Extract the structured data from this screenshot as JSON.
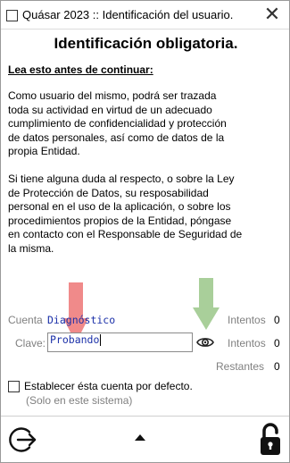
{
  "window": {
    "title": "Quásar 2023 :: Identificación del usuario.",
    "close_glyph": "✕"
  },
  "header": {
    "heading": "Identificación obligatoria.",
    "read_label": "Lea esto antes de continuar:"
  },
  "notice": {
    "paragraph1": "  Como usuario del mismo, podrá ser trazada\ntoda su actividad en virtud de un adecuado\ncumplimiento de confidencialidad y protección\nde datos personales, así como de datos de la\npropia Entidad.",
    "paragraph2": "  Si tiene alguna duda al respecto, o sobre la Ley\nde Protección de Datos, su resposabilidad\npersonal en el uso de la aplicación, o sobre los\nprocedimientos propios de la Entidad, póngase\nen contacto con el Responsable de Seguridad de\nla misma."
  },
  "form": {
    "account_label": "Cuenta",
    "account_value": "Diagnóstico",
    "password_label": "Clave:",
    "password_value": "Probando",
    "show_password_icon": "eye-icon"
  },
  "stats": {
    "attempts_label_1": "Intentos",
    "attempts_value_1": "0",
    "attempts_label_2": "Intentos",
    "attempts_value_2": "0",
    "remaining_label": "Restantes",
    "remaining_value": "0"
  },
  "default_account": {
    "checked": false,
    "label": "Establecer ésta cuenta por defecto.",
    "sublabel": "(Solo en este sistema)"
  },
  "footer": {
    "exit_icon": "exit-icon",
    "up_icon": "caret-up-icon",
    "lock_icon": "unlock-icon"
  },
  "colors": {
    "input_text": "#1a2fa8",
    "muted_text": "#808080",
    "red_arrow": "#f08a8a",
    "green_arrow": "#a9cf9a"
  }
}
